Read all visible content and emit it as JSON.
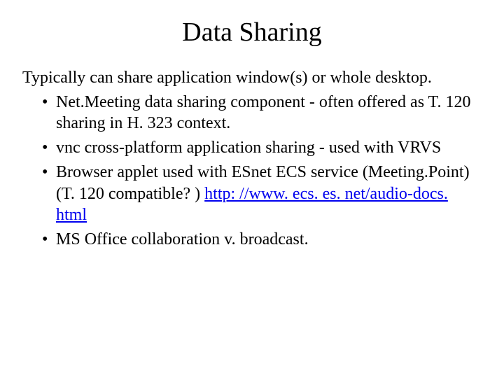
{
  "title": "Data Sharing",
  "intro": "Typically can share application window(s) or whole desktop.",
  "bullets": {
    "b0": "Net.Meeting data sharing component - often offered as T. 120 sharing in H. 323 context.",
    "b1": "vnc cross-platform application sharing - used with VRVS",
    "b2_pre": "Browser applet used with ESnet ECS service (Meeting.Point) (T. 120 compatible? ) ",
    "b2_link": "http: //www. ecs. es. net/audio-docs. html",
    "b3": "MS Office collaboration v. broadcast."
  }
}
